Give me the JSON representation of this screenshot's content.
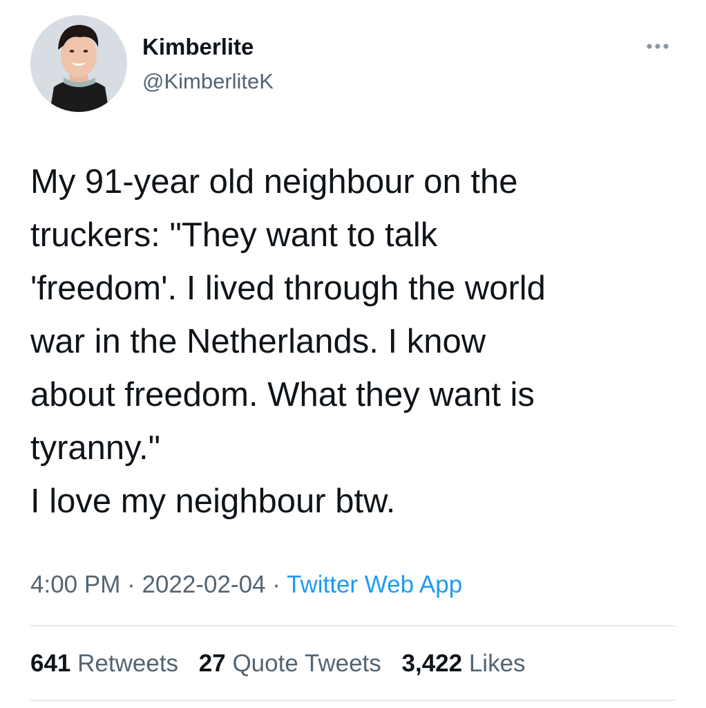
{
  "user": {
    "display_name": "Kimberlite",
    "handle": "@KimberliteK"
  },
  "icons": {
    "more": "more-horizontal-icon",
    "avatar": "profile-photo"
  },
  "tweet": {
    "text": "My 91-year old neighbour on the\ntruckers: \"They want to talk\n'freedom'. I lived through the world\nwar in the Netherlands. I know\nabout freedom. What they want is\ntyranny.\"\nI love my neighbour btw."
  },
  "meta": {
    "time": "4:00 PM",
    "separator": " · ",
    "date": "2022-02-04",
    "source": "Twitter Web App"
  },
  "stats": {
    "retweets": {
      "count": "641",
      "label": "Retweets"
    },
    "quote_tweets": {
      "count": "27",
      "label": "Quote Tweets"
    },
    "likes": {
      "count": "3,422",
      "label": "Likes"
    }
  },
  "colors": {
    "text": "#0f1419",
    "secondary": "#536471",
    "link": "#1d9bf0",
    "divider": "#e6eaed"
  }
}
